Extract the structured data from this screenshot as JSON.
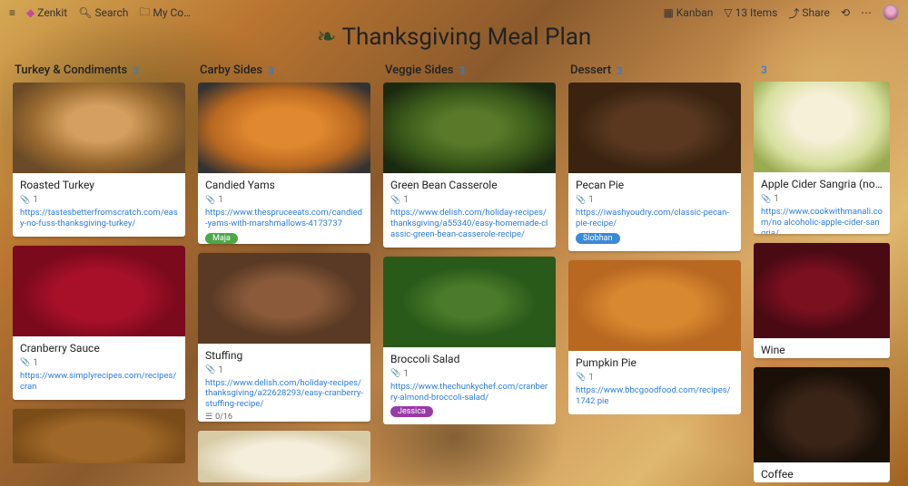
{
  "topbar": {
    "app_name": "Zenkit",
    "search_label": "Search",
    "collection_label": "My Co…",
    "view_label": "Kanban",
    "items_label": "13 Items",
    "share_label": "Share"
  },
  "title": "Thanksgiving Meal Plan",
  "columns": [
    {
      "name": "Turkey & Condiments",
      "count": "3",
      "cards": [
        {
          "title": "Roasted Turkey",
          "attachments": "1",
          "link": "https://tastesbetterfromscratch.com/easy-no-fuss-thanksgiving-turkey/",
          "img": "food-turkey"
        },
        {
          "title": "Cranberry Sauce",
          "attachments": "1",
          "link": "https://www.simplyrecipes.com/recipes/cran",
          "img": "food-cranberry"
        }
      ],
      "trailing_img": "food-gravy"
    },
    {
      "name": "Carby Sides",
      "count": "3",
      "cards": [
        {
          "title": "Candied Yams",
          "attachments": "1",
          "link": "https://www.thespruceeats.com/candied-yams-with-marshmallows-4173737",
          "img": "food-yams",
          "tag": {
            "text": "Maja",
            "color": "#4aa84a"
          }
        },
        {
          "title": "Stuffing",
          "attachments": "1",
          "link": "https://www.delish.com/holiday-recipes/thanksgiving/a22628293/easy-cranberry-stuffing-recipe/",
          "img": "food-stuffing",
          "progress": "0/16"
        }
      ],
      "trailing_img": "food-mash"
    },
    {
      "name": "Veggie Sides",
      "count": "3",
      "cards": [
        {
          "title": "Green Bean Casserole",
          "attachments": "1",
          "link": "https://www.delish.com/holiday-recipes/thanksgiving/a55340/easy-homemade-classic-green-bean-casserole-recipe/",
          "img": "food-greenbean"
        },
        {
          "title": "Broccoli Salad",
          "attachments": "1",
          "link": "https://www.thechunkychef.com/cranberry-almond-broccoli-salad/",
          "img": "food-broccoli",
          "tag": {
            "text": "Jessica",
            "color": "#9a3aa8"
          }
        }
      ]
    },
    {
      "name": "Dessert",
      "count": "3",
      "cards": [
        {
          "title": "Pecan Pie",
          "attachments": "1",
          "link": "https://iwashyoudry.com/classic-pecan-pie-recipe/",
          "img": "food-pecan",
          "tag": {
            "text": "Siobhan",
            "color": "#3a8ad8"
          }
        },
        {
          "title": "Pumpkin Pie",
          "attachments": "1",
          "link": "https://www.bbcgoodfood.com/recipes/1742 pie",
          "img": "food-pumpkin"
        }
      ]
    },
    {
      "name": "",
      "count": "3",
      "cards": [
        {
          "title": "Apple Cider Sangria (non-alcoho",
          "attachments": "1",
          "link": "https://www.cookwithmanali.com/no alcoholic-apple-cider-sangria/",
          "img": "food-sangria"
        },
        {
          "title": "Wine",
          "img": "food-wine",
          "compact": true
        },
        {
          "title": "Coffee",
          "img": "food-coffee",
          "compact": true
        }
      ]
    }
  ]
}
